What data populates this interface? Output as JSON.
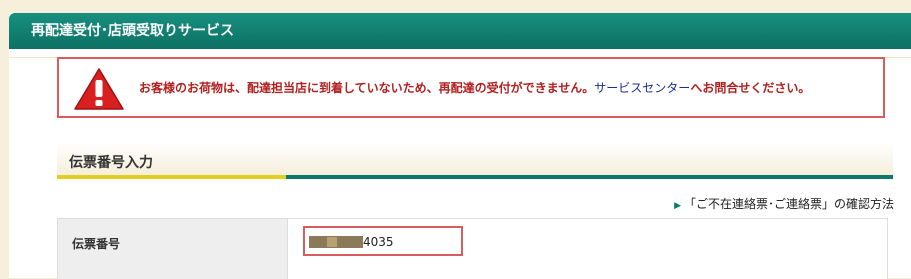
{
  "header": {
    "title": "再配達受付･店頭受取りサービス"
  },
  "alert": {
    "icon": "warning-icon",
    "message": "お客様のお荷物は、配達担当店に到着していないため、再配達の受付ができません。",
    "link_text": "サービスセンター",
    "message_tail": "へお問合せください。"
  },
  "section": {
    "title": "伝票番号入力"
  },
  "help_link": {
    "text": "「ご不在連絡票･ご連絡票」の確認方法"
  },
  "form": {
    "tracking_label": "伝票番号",
    "tracking_value": "4035"
  },
  "colors": {
    "header": "#0d7163",
    "alert_border": "#d95d5d",
    "alert_text": "#b32020",
    "link": "#1a2c8c",
    "accent_yellow": "#e3cf22"
  }
}
